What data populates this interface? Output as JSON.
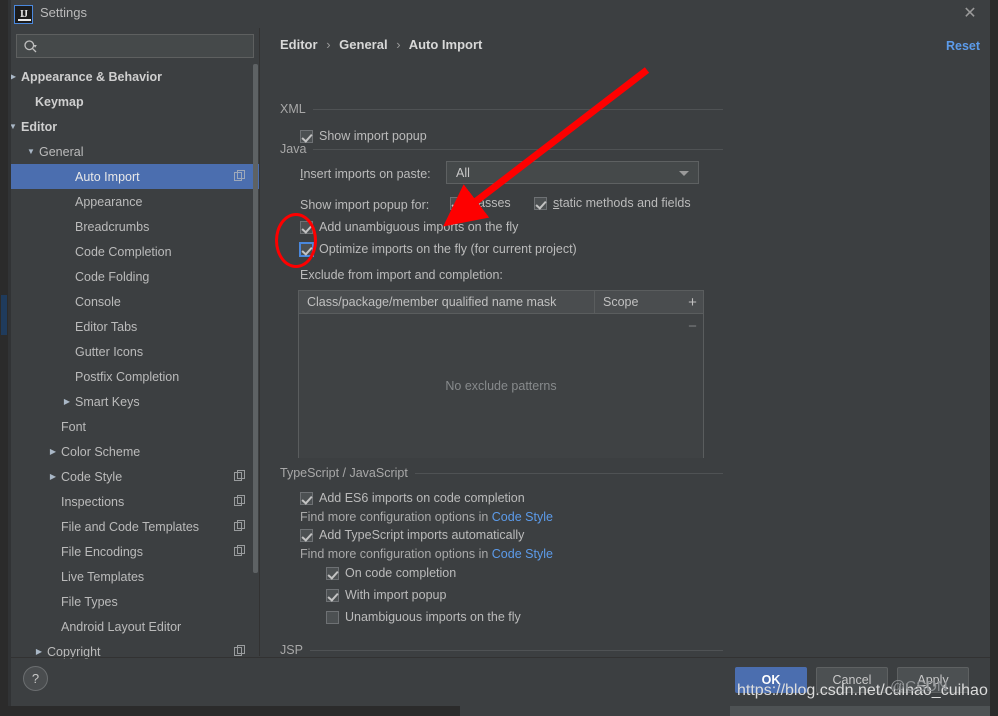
{
  "window": {
    "title": "Settings",
    "app_icon": "intellij-idea-icon",
    "close_icon": "close-icon"
  },
  "search": {
    "placeholder": "",
    "value": "",
    "icon": "search-icon"
  },
  "sidebar": {
    "scrollbar": "sidebar-scrollbar",
    "items": [
      {
        "label": "Appearance & Behavior",
        "indent": 10,
        "arrow": "collapsed",
        "bold": true,
        "selected": false,
        "project_icon": false
      },
      {
        "label": "Keymap",
        "indent": 24,
        "arrow": "none",
        "bold": true,
        "selected": false,
        "project_icon": false
      },
      {
        "label": "Editor",
        "indent": 10,
        "arrow": "expanded",
        "bold": true,
        "selected": false,
        "project_icon": false
      },
      {
        "label": "General",
        "indent": 28,
        "arrow": "expanded",
        "bold": false,
        "selected": false,
        "project_icon": false
      },
      {
        "label": "Auto Import",
        "indent": 64,
        "arrow": "none",
        "bold": false,
        "selected": true,
        "project_icon": true
      },
      {
        "label": "Appearance",
        "indent": 64,
        "arrow": "none",
        "bold": false,
        "selected": false,
        "project_icon": false
      },
      {
        "label": "Breadcrumbs",
        "indent": 64,
        "arrow": "none",
        "bold": false,
        "selected": false,
        "project_icon": false
      },
      {
        "label": "Code Completion",
        "indent": 64,
        "arrow": "none",
        "bold": false,
        "selected": false,
        "project_icon": false
      },
      {
        "label": "Code Folding",
        "indent": 64,
        "arrow": "none",
        "bold": false,
        "selected": false,
        "project_icon": false
      },
      {
        "label": "Console",
        "indent": 64,
        "arrow": "none",
        "bold": false,
        "selected": false,
        "project_icon": false
      },
      {
        "label": "Editor Tabs",
        "indent": 64,
        "arrow": "none",
        "bold": false,
        "selected": false,
        "project_icon": false
      },
      {
        "label": "Gutter Icons",
        "indent": 64,
        "arrow": "none",
        "bold": false,
        "selected": false,
        "project_icon": false
      },
      {
        "label": "Postfix Completion",
        "indent": 64,
        "arrow": "none",
        "bold": false,
        "selected": false,
        "project_icon": false
      },
      {
        "label": "Smart Keys",
        "indent": 64,
        "arrow": "collapsed",
        "bold": false,
        "selected": false,
        "project_icon": false
      },
      {
        "label": "Font",
        "indent": 50,
        "arrow": "none",
        "bold": false,
        "selected": false,
        "project_icon": false
      },
      {
        "label": "Color Scheme",
        "indent": 50,
        "arrow": "collapsed",
        "bold": false,
        "selected": false,
        "project_icon": false
      },
      {
        "label": "Code Style",
        "indent": 50,
        "arrow": "collapsed",
        "bold": false,
        "selected": false,
        "project_icon": true
      },
      {
        "label": "Inspections",
        "indent": 50,
        "arrow": "none",
        "bold": false,
        "selected": false,
        "project_icon": true
      },
      {
        "label": "File and Code Templates",
        "indent": 50,
        "arrow": "none",
        "bold": false,
        "selected": false,
        "project_icon": true
      },
      {
        "label": "File Encodings",
        "indent": 50,
        "arrow": "none",
        "bold": false,
        "selected": false,
        "project_icon": true
      },
      {
        "label": "Live Templates",
        "indent": 50,
        "arrow": "none",
        "bold": false,
        "selected": false,
        "project_icon": false
      },
      {
        "label": "File Types",
        "indent": 50,
        "arrow": "none",
        "bold": false,
        "selected": false,
        "project_icon": false
      },
      {
        "label": "Android Layout Editor",
        "indent": 50,
        "arrow": "none",
        "bold": false,
        "selected": false,
        "project_icon": false
      },
      {
        "label": "Copyright",
        "indent": 36,
        "arrow": "collapsed",
        "bold": false,
        "selected": false,
        "project_icon": true
      }
    ]
  },
  "content": {
    "breadcrumb": {
      "root": "Editor",
      "middle": "General",
      "leaf": "Auto Import",
      "separator": "›"
    },
    "reset_label": "Reset",
    "sections": {
      "xml": {
        "title": "XML",
        "show_import_popup": {
          "label": "Show import popup",
          "checked": true
        }
      },
      "java": {
        "title": "Java",
        "insert_imports_label": "Insert imports on paste:",
        "insert_imports_value": "All",
        "show_import_popup_for_label": "Show import popup for:",
        "classes": {
          "label": "classes",
          "checked": true
        },
        "static_methods": {
          "label": "static methods and fields",
          "checked": true
        },
        "add_unambiguous": {
          "label": "Add unambiguous imports on the fly",
          "checked": true
        },
        "optimize_imports": {
          "label": "Optimize imports on the fly (for current project)",
          "checked": true
        },
        "exclude_label": "Exclude from import and completion:",
        "table": {
          "columns": [
            "Class/package/member qualified name mask",
            "Scope"
          ],
          "rows": [],
          "empty_text": "No exclude patterns",
          "add_label": "+",
          "remove_label": "−"
        }
      },
      "typescript": {
        "title": "TypeScript / JavaScript",
        "add_es6": {
          "label": "Add ES6 imports on code completion",
          "checked": true
        },
        "hint1_prefix": "Find more configuration options in ",
        "hint1_link": "Code Style",
        "add_ts": {
          "label": "Add TypeScript imports automatically",
          "checked": true
        },
        "hint2_prefix": "Find more configuration options in ",
        "hint2_link": "Code Style",
        "on_code_completion": {
          "label": "On code completion",
          "checked": true
        },
        "with_import_popup": {
          "label": "With import popup",
          "checked": true
        },
        "unambiguous_on_fly": {
          "label": "Unambiguous imports on the fly",
          "checked": false
        }
      },
      "jsp": {
        "title": "JSP"
      }
    }
  },
  "footer": {
    "help_label": "?",
    "ok_label": "OK",
    "cancel_label": "Cancel",
    "apply_label": "Apply"
  },
  "annotations": {
    "ellipse_color": "#fe0000",
    "arrow_color": "#fe0000",
    "watermark": "https://blog.csdn.net/cuihao_cuihao",
    "watermark_logo": "@CSDN"
  },
  "colors": {
    "dialog_bg": "#3c3f41",
    "selection": "#4b6eaf",
    "link": "#5c9bea",
    "text": "#bbbbbb",
    "annotation_red": "#fe0000"
  }
}
